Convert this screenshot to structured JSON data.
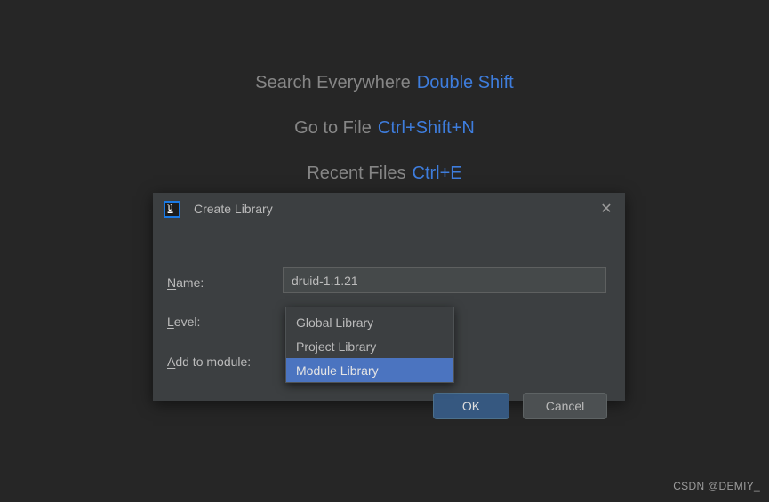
{
  "background": {
    "bg_color": "#262626",
    "hints": [
      {
        "action": "Search Everywhere",
        "shortcut": "Double Shift"
      },
      {
        "action": "Go to File",
        "shortcut": "Ctrl+Shift+N"
      },
      {
        "action": "Recent Files",
        "shortcut": "Ctrl+E"
      }
    ],
    "action_color": "#868686",
    "shortcut_color": "#3e7ddd"
  },
  "dialog": {
    "title": "Create Library",
    "app_icon": "intellij-idea-icon",
    "close_icon": "close-icon",
    "fields": {
      "name": {
        "label_mnemonic": "N",
        "label_rest": "ame:",
        "value": "druid-1.1.21",
        "placeholder": ""
      },
      "level": {
        "label_mnemonic": "L",
        "label_rest": "evel:",
        "value": "Project Library",
        "arrow_icon": "chevron-down-icon",
        "options": [
          "Global Library",
          "Project Library",
          "Module Library"
        ],
        "highlighted_option": "Module Library",
        "highlight_color": "#4b74c0",
        "focus_ring_color": "#3d76bf"
      },
      "add_to_module": {
        "label_mnemonic": "A",
        "label_rest": "dd to module:",
        "value": ""
      }
    },
    "buttons": {
      "ok": "OK",
      "cancel": "Cancel",
      "ok_color": "#365880"
    }
  },
  "watermark": "CSDN @DEMIY_"
}
